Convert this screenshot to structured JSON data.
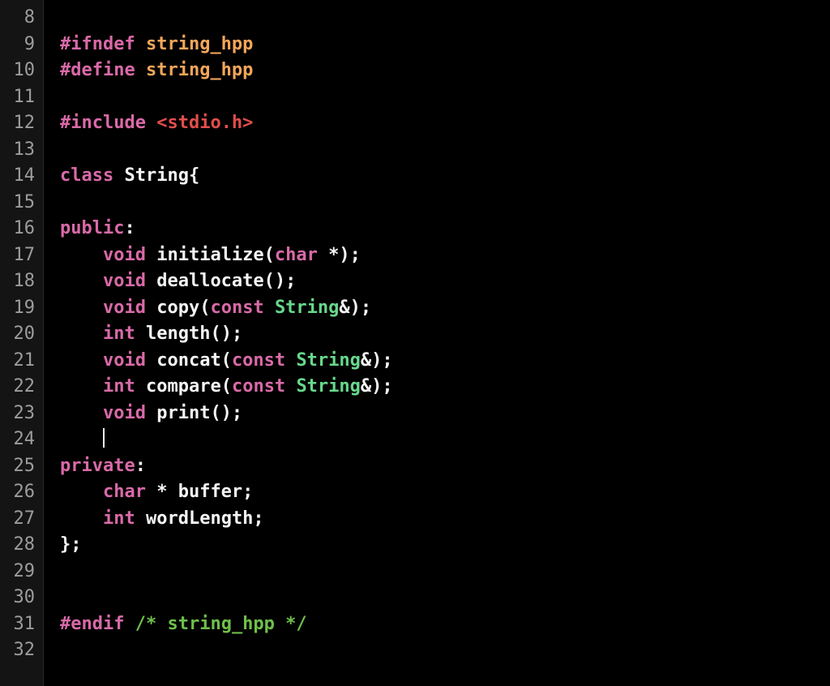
{
  "gutter": {
    "start": 8,
    "end": 32
  },
  "colors": {
    "background": "#000000",
    "gutter_bg": "#141414",
    "gutter_fg": "#9d9d9d",
    "directive": "#d96aa8",
    "macroname": "#f4a65a",
    "include_header": "#e24d4d",
    "keyword": "#d96aa8",
    "type": "#67d88b",
    "plain": "#f5f5f5",
    "comment": "#6fbf4b"
  },
  "lines": {
    "l8": [],
    "l9": [
      {
        "cls": "tok-directive",
        "text": "#ifndef"
      },
      {
        "cls": "tok-plain",
        "text": " "
      },
      {
        "cls": "tok-macroname",
        "text": "string_hpp"
      }
    ],
    "l10": [
      {
        "cls": "tok-directive",
        "text": "#define"
      },
      {
        "cls": "tok-plain",
        "text": " "
      },
      {
        "cls": "tok-macroname",
        "text": "string_hpp"
      }
    ],
    "l11": [],
    "l12": [
      {
        "cls": "tok-directive",
        "text": "#include"
      },
      {
        "cls": "tok-plain",
        "text": " "
      },
      {
        "cls": "tok-include-header",
        "text": "<stdio.h>"
      }
    ],
    "l13": [],
    "l14": [
      {
        "cls": "tok-keyword",
        "text": "class"
      },
      {
        "cls": "tok-plain",
        "text": " String{"
      }
    ],
    "l15": [],
    "l16": [
      {
        "cls": "tok-keyword",
        "text": "public"
      },
      {
        "cls": "tok-plain",
        "text": ":"
      }
    ],
    "l17": [
      {
        "cls": "tok-plain",
        "text": "    "
      },
      {
        "cls": "tok-keyword",
        "text": "void"
      },
      {
        "cls": "tok-plain",
        "text": " initialize("
      },
      {
        "cls": "tok-keyword",
        "text": "char"
      },
      {
        "cls": "tok-plain",
        "text": " *);"
      }
    ],
    "l18": [
      {
        "cls": "tok-plain",
        "text": "    "
      },
      {
        "cls": "tok-keyword",
        "text": "void"
      },
      {
        "cls": "tok-plain",
        "text": " deallocate();"
      }
    ],
    "l19": [
      {
        "cls": "tok-plain",
        "text": "    "
      },
      {
        "cls": "tok-keyword",
        "text": "void"
      },
      {
        "cls": "tok-plain",
        "text": " copy("
      },
      {
        "cls": "tok-keyword",
        "text": "const"
      },
      {
        "cls": "tok-plain",
        "text": " "
      },
      {
        "cls": "tok-type",
        "text": "String"
      },
      {
        "cls": "tok-plain",
        "text": "&);"
      }
    ],
    "l20": [
      {
        "cls": "tok-plain",
        "text": "    "
      },
      {
        "cls": "tok-keyword",
        "text": "int"
      },
      {
        "cls": "tok-plain",
        "text": " length();"
      }
    ],
    "l21": [
      {
        "cls": "tok-plain",
        "text": "    "
      },
      {
        "cls": "tok-keyword",
        "text": "void"
      },
      {
        "cls": "tok-plain",
        "text": " concat("
      },
      {
        "cls": "tok-keyword",
        "text": "const"
      },
      {
        "cls": "tok-plain",
        "text": " "
      },
      {
        "cls": "tok-type",
        "text": "String"
      },
      {
        "cls": "tok-plain",
        "text": "&);"
      }
    ],
    "l22": [
      {
        "cls": "tok-plain",
        "text": "    "
      },
      {
        "cls": "tok-keyword",
        "text": "int"
      },
      {
        "cls": "tok-plain",
        "text": " compare("
      },
      {
        "cls": "tok-keyword",
        "text": "const"
      },
      {
        "cls": "tok-plain",
        "text": " "
      },
      {
        "cls": "tok-type",
        "text": "String"
      },
      {
        "cls": "tok-plain",
        "text": "&);"
      }
    ],
    "l23": [
      {
        "cls": "tok-plain",
        "text": "    "
      },
      {
        "cls": "tok-keyword",
        "text": "void"
      },
      {
        "cls": "tok-plain",
        "text": " print();"
      }
    ],
    "l24": [
      {
        "cls": "tok-plain",
        "text": "    "
      },
      {
        "cls": "cursor",
        "text": ""
      }
    ],
    "l25": [
      {
        "cls": "tok-keyword",
        "text": "private"
      },
      {
        "cls": "tok-plain",
        "text": ":"
      }
    ],
    "l26": [
      {
        "cls": "tok-plain",
        "text": "    "
      },
      {
        "cls": "tok-keyword",
        "text": "char"
      },
      {
        "cls": "tok-plain",
        "text": " * buffer;"
      }
    ],
    "l27": [
      {
        "cls": "tok-plain",
        "text": "    "
      },
      {
        "cls": "tok-keyword",
        "text": "int"
      },
      {
        "cls": "tok-plain",
        "text": " wordLength;"
      }
    ],
    "l28": [
      {
        "cls": "tok-plain",
        "text": "};"
      }
    ],
    "l29": [],
    "l30": [],
    "l31": [
      {
        "cls": "tok-directive",
        "text": "#endif"
      },
      {
        "cls": "tok-plain",
        "text": " "
      },
      {
        "cls": "tok-comment",
        "text": "/* string_hpp */"
      }
    ],
    "l32": []
  }
}
